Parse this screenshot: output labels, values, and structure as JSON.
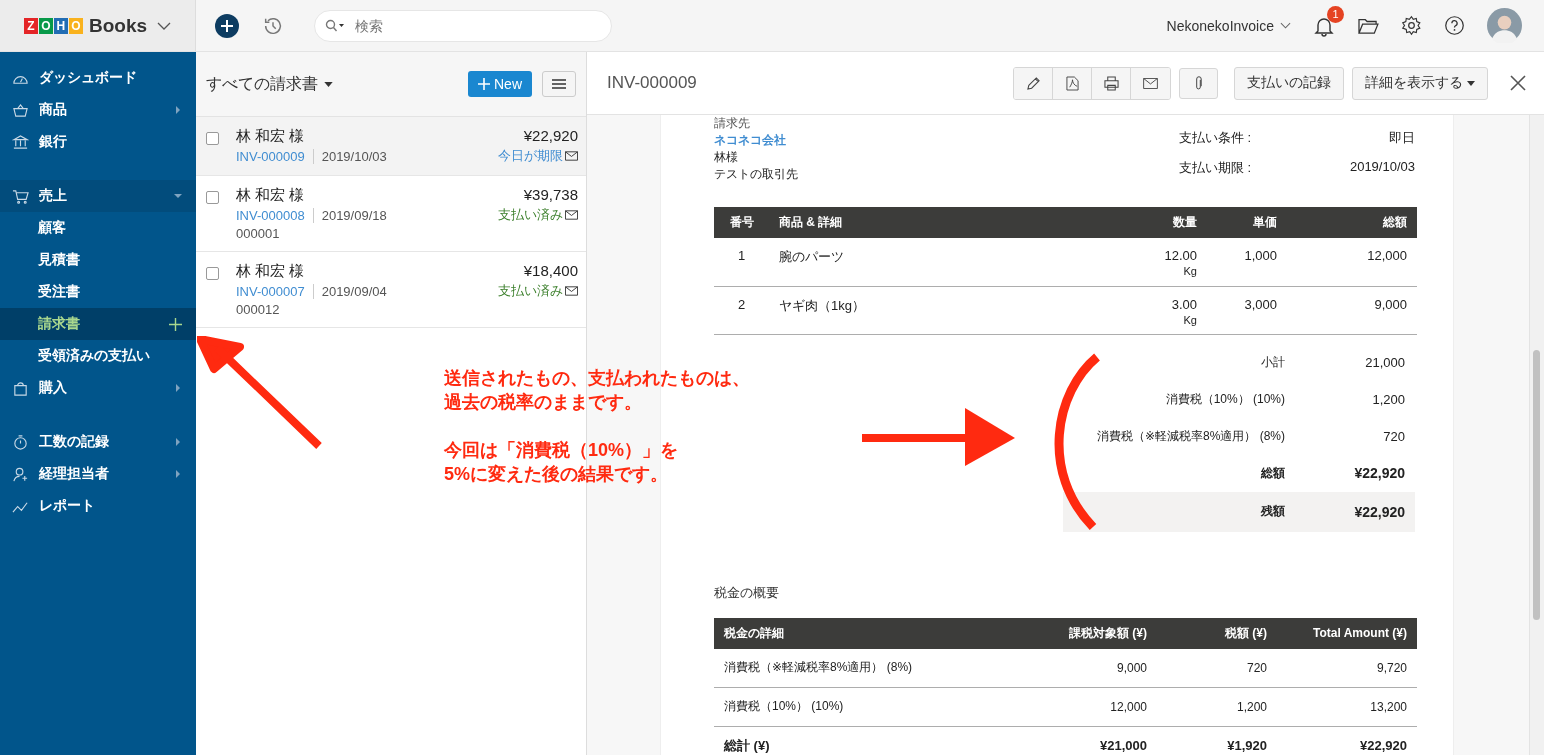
{
  "topbar": {
    "logo_letters": [
      {
        "letter": "Z",
        "color": "#e42527"
      },
      {
        "letter": "O",
        "color": "#089949"
      },
      {
        "letter": "H",
        "color": "#226db4"
      },
      {
        "letter": "O",
        "color": "#f9b21d"
      }
    ],
    "app_name": "Books",
    "search": {
      "placeholder": "検索"
    },
    "organization": "NekonekoInvoice",
    "notification_count": "1"
  },
  "sidebar": {
    "groups": [
      [
        {
          "label": "ダッシュボード",
          "has_arrow": false
        },
        {
          "label": "商品",
          "has_arrow": true
        },
        {
          "label": "銀行",
          "has_arrow": false
        }
      ],
      [
        {
          "label": "売上",
          "has_arrow": true,
          "expanded": true,
          "children": [
            {
              "label": "顧客",
              "selected": false
            },
            {
              "label": "見積書",
              "selected": false
            },
            {
              "label": "受注書",
              "selected": false
            },
            {
              "label": "請求書",
              "selected": true
            },
            {
              "label": "受領済みの支払い",
              "selected": false
            }
          ]
        },
        {
          "label": "購入",
          "has_arrow": true
        }
      ],
      [
        {
          "label": "工数の記録",
          "has_arrow": true
        },
        {
          "label": "経理担当者",
          "has_arrow": true
        },
        {
          "label": "レポート",
          "has_arrow": false
        }
      ]
    ]
  },
  "invoice_list": {
    "title": "すべての請求書",
    "new_button": "New",
    "rows": [
      {
        "selected": true,
        "checked": false,
        "customer": "林 和宏 様",
        "number": "INV-000009",
        "date": "2019/10/03",
        "amount": "¥22,920",
        "status": "今日が期限",
        "color": "#408dd1"
      },
      {
        "selected": false,
        "checked": false,
        "customer": "林 和宏 様",
        "number": "INV-000008",
        "date": "2019/09/18",
        "reference": "000001",
        "amount": "¥39,738",
        "status": "支払い済み",
        "color": "#3b7f2b"
      },
      {
        "selected": false,
        "checked": false,
        "customer": "林 和宏 様",
        "number": "INV-000007",
        "date": "2019/09/04",
        "reference": "000012",
        "amount": "¥18,400",
        "status": "支払い済み",
        "color": "#3b7f2b"
      }
    ]
  },
  "detail": {
    "title": "INV-000009",
    "record_payment": "支払いの記録",
    "more": "詳細を表示する",
    "invoice": {
      "bill_to_label": "請求先",
      "customer_name": "ネコネコ会社",
      "address_lines": [
        "林様",
        "テストの取引先"
      ],
      "terms": [
        {
          "label": "支払い条件 :",
          "value": "即日"
        },
        {
          "label": "支払い期限 :",
          "value": "2019/10/03"
        }
      ],
      "items": {
        "columns": [
          "番号",
          "商品 & 詳細",
          "数量",
          "単価",
          "総額"
        ],
        "rows": [
          {
            "no": "1",
            "name": "腕のパーツ",
            "quantity": "12.00",
            "unit": "Kg",
            "rate": "1,000",
            "amount": "12,000"
          },
          {
            "no": "2",
            "name": "ヤギ肉（1kg）",
            "quantity": "3.00",
            "unit": "Kg",
            "rate": "3,000",
            "amount": "9,000"
          }
        ]
      },
      "totals": [
        {
          "kind": "plain",
          "label": "小計",
          "value": "21,000"
        },
        {
          "kind": "plain",
          "label": "消費税（10%） (10%)",
          "value": "1,200"
        },
        {
          "kind": "plain",
          "label": "消費税（※軽減税率8%適用） (8%)",
          "value": "720"
        },
        {
          "kind": "bold",
          "label": "総額",
          "value": "¥22,920"
        },
        {
          "kind": "balance",
          "label": "残額",
          "value": "¥22,920"
        }
      ],
      "tax_summary": {
        "title": "税金の概要",
        "columns": [
          "税金の詳細",
          "課税対象額 (¥)",
          "税額 (¥)",
          "Total Amount (¥)"
        ],
        "rows": [
          {
            "kind": "plain",
            "cells": [
              "消費税（※軽減税率8%適用） (8%)",
              "9,000",
              "720",
              "9,720"
            ]
          },
          {
            "kind": "plain",
            "cells": [
              "消費税（10%） (10%)",
              "12,000",
              "1,200",
              "13,200"
            ]
          },
          {
            "kind": "total",
            "cells": [
              "総計 (¥)",
              "¥21,000",
              "¥1,920",
              "¥22,920"
            ]
          }
        ]
      }
    }
  },
  "annotation": {
    "paragraphs": [
      [
        "送信されたもの、支払われたものは、",
        "過去の税率のままです。"
      ],
      [
        "今回は「消費税（10%）」を",
        "5%に変えた後の結果です。"
      ]
    ]
  }
}
